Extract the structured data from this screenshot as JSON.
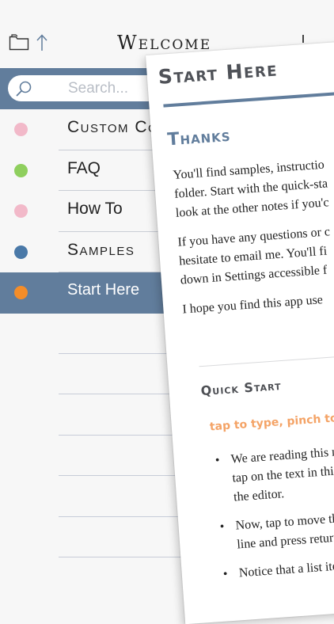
{
  "header": {
    "title": "Welcome"
  },
  "search": {
    "placeholder": "Search..."
  },
  "notes": [
    {
      "label": "Custom Co",
      "color": "#f2b9c9",
      "small_caps": true
    },
    {
      "label": "FAQ",
      "color": "#8fcf5e",
      "small_caps": false
    },
    {
      "label": "How To",
      "color": "#f2b9c9",
      "small_caps": false
    },
    {
      "label": "Samples",
      "color": "#4a79a8",
      "small_caps": true
    },
    {
      "label": "Start Here",
      "color": "#f48d29",
      "small_caps": false,
      "selected": true
    }
  ],
  "preview": {
    "title": "Start Here",
    "heading": "Thanks",
    "paragraphs": [
      [
        "You'll find samples, instructio",
        "folder. Start with the quick-sta",
        "look at the other notes if you'c"
      ],
      [
        "If you have any questions or c",
        "hesitate to email me. You'll fi",
        "down in Settings accessible f"
      ],
      [
        "I hope you find this app use"
      ]
    ],
    "subheading": "Quick Start",
    "hint": "tap to type, pinch to previ",
    "bullets": [
      [
        "We are reading this no",
        "tap on the text in this",
        "the editor."
      ],
      [
        "Now, tap to move th",
        "line and press returr"
      ],
      [
        "Notice that a list ite"
      ]
    ]
  },
  "colors": {
    "accent": "#617d9c",
    "hint": "#f4a366"
  }
}
